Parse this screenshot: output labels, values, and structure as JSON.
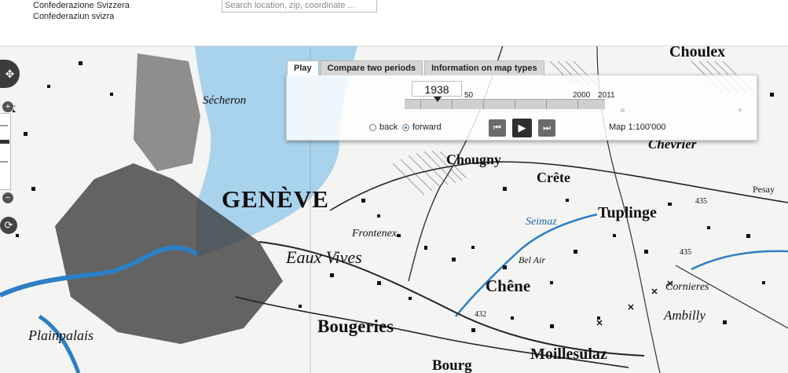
{
  "header": {
    "org_line1": "Confederazione Svizzera",
    "org_line2": "Confederaziun svizra",
    "search_placeholder": "Search location, zip, coordinate ..."
  },
  "map": {
    "labels": {
      "geneve": "GENÈVE",
      "secheron": "Sécheron",
      "chougny": "Chougny",
      "crete": "Crête",
      "tuplinge": "Tuplinge",
      "chevrier": "Chevrier",
      "frontenex": "Frontenex",
      "eauxvives": "Eaux Vives",
      "seimaz": "Seimaz",
      "belair": "Bel Air",
      "chene": "Chêne",
      "cornieres": "Cornieres",
      "ambilly": "Ambilly",
      "bougeries": "Bougeries",
      "plainpalais": "Plainpalais",
      "moillesulaz": "Moillesulaz",
      "bourg": "Bourg",
      "choulex": "Choulex",
      "pesay": "Pesay",
      "ex": "ex",
      "elev_435": "435",
      "elev_432": "432"
    },
    "water_color": "#a9d2ec",
    "river_color": "#2c7fc4"
  },
  "timetravel": {
    "tabs": [
      "Play",
      "Compare two periods",
      "Information on map types"
    ],
    "active_tab": "Play",
    "year": "1938",
    "timeline_labels": [
      "50",
      "2000",
      "2011"
    ],
    "direction_back": "back",
    "direction_forward": "forward",
    "direction_selected": "forward",
    "scale": "Map 1:100'000"
  },
  "icons": {
    "pan": "pan-arrows-icon",
    "zoom_in": "plus-icon",
    "zoom_out": "minus-icon",
    "rotate": "rotate-icon",
    "first": "skip-back-icon",
    "play": "play-icon",
    "last": "skip-forward-icon"
  }
}
